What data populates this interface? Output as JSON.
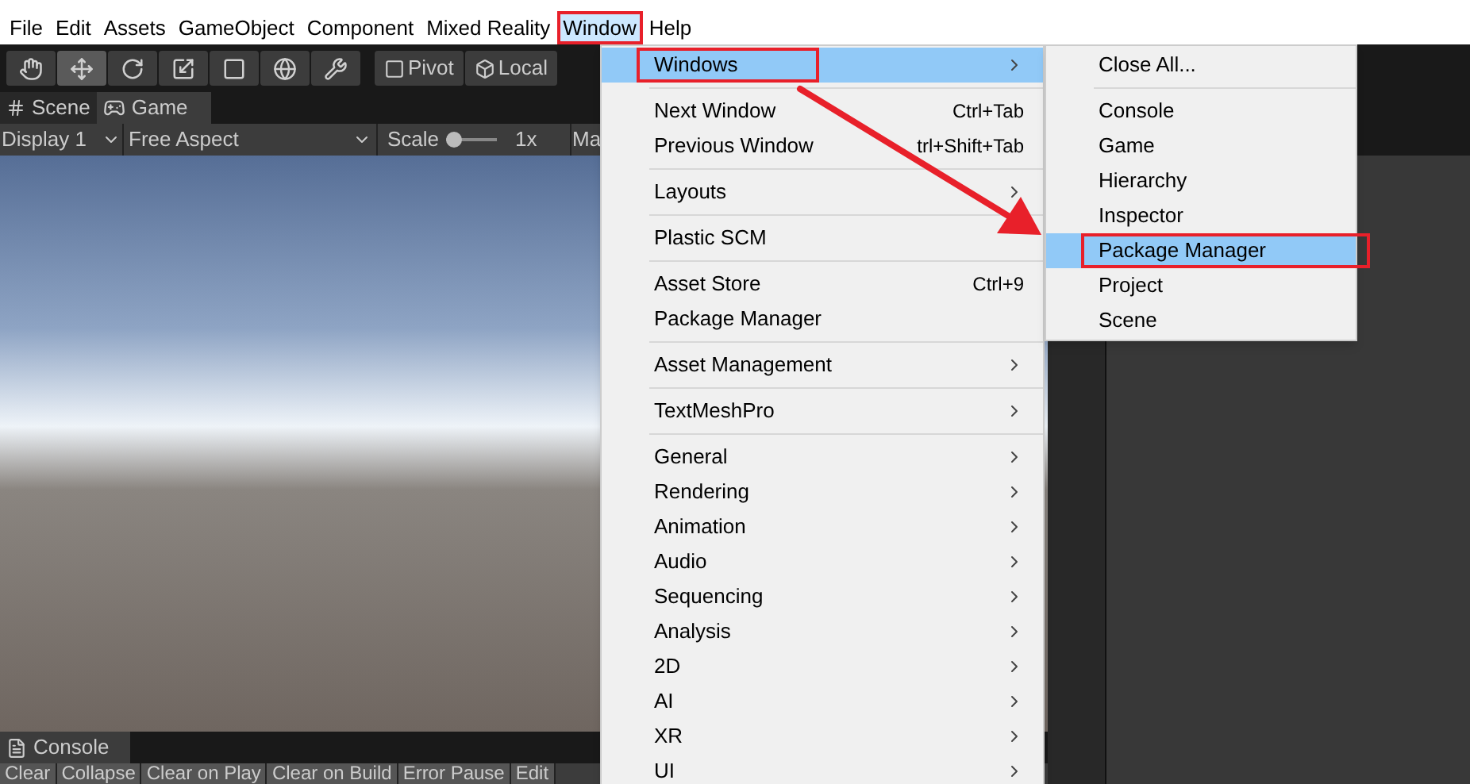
{
  "menubar": [
    {
      "label": "File",
      "selected": false,
      "annotated": false
    },
    {
      "label": "Edit",
      "selected": false,
      "annotated": false
    },
    {
      "label": "Assets",
      "selected": false,
      "annotated": false
    },
    {
      "label": "GameObject",
      "selected": false,
      "annotated": false
    },
    {
      "label": "Component",
      "selected": false,
      "annotated": false
    },
    {
      "label": "Mixed Reality",
      "selected": false,
      "annotated": false
    },
    {
      "label": "Window",
      "selected": true,
      "annotated": true
    },
    {
      "label": "Help",
      "selected": false,
      "annotated": false
    }
  ],
  "toolbar": {
    "tools": [
      {
        "kind": "hand",
        "selected": false
      },
      {
        "kind": "move",
        "selected": true
      },
      {
        "kind": "rotate",
        "selected": false
      },
      {
        "kind": "scale",
        "selected": false
      },
      {
        "kind": "rect",
        "selected": false
      },
      {
        "kind": "transform",
        "selected": false
      },
      {
        "kind": "custom",
        "selected": false
      }
    ],
    "pivot": "Pivot",
    "local": "Local"
  },
  "view_tabs": [
    {
      "label": "Scene",
      "kind": "scene",
      "selected": false
    },
    {
      "label": "Game",
      "kind": "game",
      "selected": true
    }
  ],
  "game_toolbar": {
    "display": "Display 1",
    "aspect": "Free Aspect",
    "scale_label": "Scale",
    "scale": {
      "level": 0
    },
    "scale_value": "1x",
    "cut_label": "Ma"
  },
  "console": {
    "tab": "Console",
    "buttons": [
      "Clear",
      "Collapse",
      "Clear on Play",
      "Clear on Build",
      "Error Pause",
      "Edit"
    ]
  },
  "window_menu": [
    {
      "kind": "item",
      "label": "Windows",
      "submenu": true,
      "selected": true,
      "annotated": true
    },
    {
      "kind": "separator"
    },
    {
      "kind": "item",
      "label": "Next Window",
      "shortcut": "Ctrl+Tab",
      "submenu": false,
      "selected": false,
      "annotated": false
    },
    {
      "kind": "item",
      "label": "Previous Window",
      "shortcut": "trl+Shift+Tab",
      "submenu": false,
      "selected": false,
      "annotated": false
    },
    {
      "kind": "separator"
    },
    {
      "kind": "item",
      "label": "Layouts",
      "submenu": true,
      "selected": false,
      "annotated": false
    },
    {
      "kind": "separator"
    },
    {
      "kind": "item",
      "label": "Plastic SCM",
      "submenu": false,
      "selected": false,
      "annotated": false
    },
    {
      "kind": "separator"
    },
    {
      "kind": "item",
      "label": "Asset Store",
      "shortcut": "Ctrl+9",
      "submenu": false,
      "selected": false,
      "annotated": false
    },
    {
      "kind": "item",
      "label": "Package Manager",
      "submenu": false,
      "selected": false,
      "annotated": false
    },
    {
      "kind": "separator"
    },
    {
      "kind": "item",
      "label": "Asset Management",
      "submenu": true,
      "selected": false,
      "annotated": false
    },
    {
      "kind": "separator"
    },
    {
      "kind": "item",
      "label": "TextMeshPro",
      "submenu": true,
      "selected": false,
      "annotated": false
    },
    {
      "kind": "separator"
    },
    {
      "kind": "item",
      "label": "General",
      "submenu": true,
      "selected": false,
      "annotated": false
    },
    {
      "kind": "item",
      "label": "Rendering",
      "submenu": true,
      "selected": false,
      "annotated": false
    },
    {
      "kind": "item",
      "label": "Animation",
      "submenu": true,
      "selected": false,
      "annotated": false
    },
    {
      "kind": "item",
      "label": "Audio",
      "submenu": true,
      "selected": false,
      "annotated": false
    },
    {
      "kind": "item",
      "label": "Sequencing",
      "submenu": true,
      "selected": false,
      "annotated": false
    },
    {
      "kind": "item",
      "label": "Analysis",
      "submenu": true,
      "selected": false,
      "annotated": false
    },
    {
      "kind": "item",
      "label": "2D",
      "submenu": true,
      "selected": false,
      "annotated": false
    },
    {
      "kind": "item",
      "label": "AI",
      "submenu": true,
      "selected": false,
      "annotated": false
    },
    {
      "kind": "item",
      "label": "XR",
      "submenu": true,
      "selected": false,
      "annotated": false
    },
    {
      "kind": "item",
      "label": "UI",
      "submenu": true,
      "selected": false,
      "annotated": false
    }
  ],
  "windows_submenu": [
    {
      "kind": "item",
      "label": "Close All...",
      "selected": false,
      "annotated": false
    },
    {
      "kind": "separator"
    },
    {
      "kind": "item",
      "label": "Console",
      "selected": false,
      "annotated": false
    },
    {
      "kind": "item",
      "label": "Game",
      "selected": false,
      "annotated": false
    },
    {
      "kind": "item",
      "label": "Hierarchy",
      "selected": false,
      "annotated": false
    },
    {
      "kind": "item",
      "label": "Inspector",
      "selected": false,
      "annotated": false
    },
    {
      "kind": "item",
      "label": "Package Manager",
      "selected": true,
      "annotated": true
    },
    {
      "kind": "item",
      "label": "Project",
      "selected": false,
      "annotated": false
    },
    {
      "kind": "item",
      "label": "Scene",
      "selected": false,
      "annotated": false
    }
  ]
}
